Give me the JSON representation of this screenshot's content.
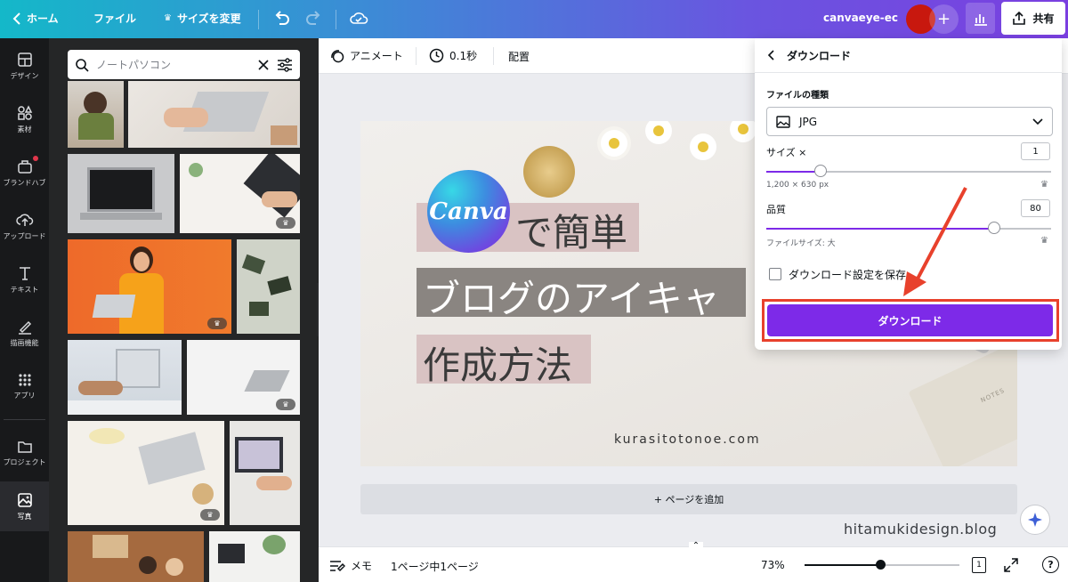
{
  "topbar": {
    "home": "ホーム",
    "file": "ファイル",
    "resize": "サイズを変更",
    "project_name": "canvaeye-ec",
    "share": "共有"
  },
  "leftnav": {
    "items": [
      {
        "label": "デザイン",
        "icon": "design-icon"
      },
      {
        "label": "素材",
        "icon": "elements-icon"
      },
      {
        "label": "ブランドハブ",
        "icon": "brand-hub-icon"
      },
      {
        "label": "アップロード",
        "icon": "upload-icon"
      },
      {
        "label": "テキスト",
        "icon": "text-icon"
      },
      {
        "label": "描画機能",
        "icon": "draw-icon"
      },
      {
        "label": "アプリ",
        "icon": "apps-icon"
      },
      {
        "label": "プロジェクト",
        "icon": "folder-icon"
      },
      {
        "label": "写真",
        "icon": "photo-icon"
      }
    ]
  },
  "sidepanel": {
    "search_value": "ノートパソコン"
  },
  "context_bar": {
    "animate": "アニメート",
    "duration": "0.1秒",
    "position": "配置"
  },
  "design": {
    "logo_text": "Canva",
    "line1": "で簡単",
    "line2": "ブログのアイキャ",
    "line3": "作成方法",
    "url": "kurasitotonoe.com"
  },
  "add_page": "+ ページを追加",
  "watermark": "hitamukidesign.blog",
  "bottombar": {
    "notes": "メモ",
    "pages": "1ページ中1ページ",
    "zoom": "73%",
    "zoom_level": 0.73,
    "page_count_icon": "1"
  },
  "download_panel": {
    "title": "ダウンロード",
    "file_type_label": "ファイルの種類",
    "file_type": "JPG",
    "size_label": "サイズ ×",
    "size_value": "1",
    "size_dims": "1,200 × 630 px",
    "quality_label": "品質",
    "quality_value": "80",
    "file_size": "ファイルサイズ: 大",
    "save_settings": "ダウンロード設定を保存",
    "download_button": "ダウンロード"
  },
  "colors": {
    "accent": "#7d2ae8",
    "highlight": "#e8412c"
  }
}
